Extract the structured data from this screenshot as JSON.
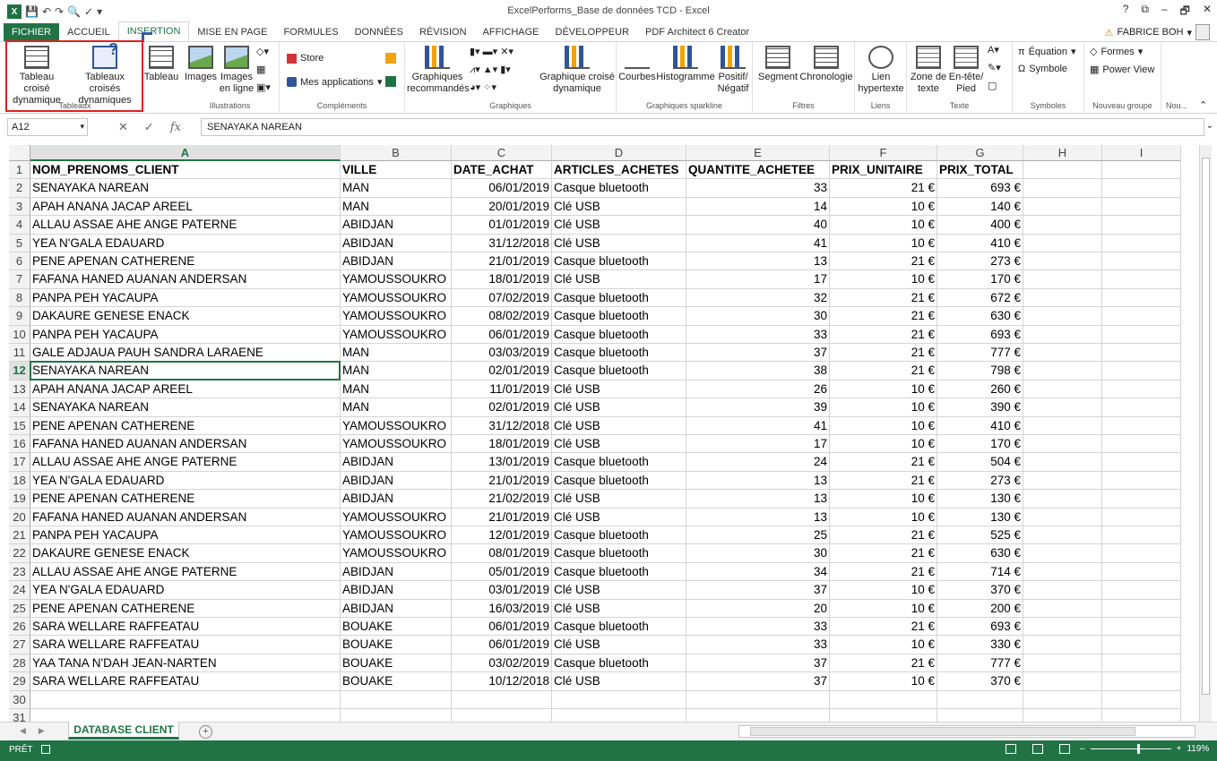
{
  "window": {
    "title": "ExcelPerforms_Base de données TCD - Excel",
    "controls": [
      "?",
      "⧉",
      "–",
      "🗗",
      "✕"
    ]
  },
  "tabs": [
    "FICHIER",
    "ACCUEIL",
    "INSERTION",
    "MISE EN PAGE",
    "FORMULES",
    "DONNÉES",
    "RÉVISION",
    "AFFICHAGE",
    "DÉVELOPPEUR",
    "PDF Architect 6 Creator"
  ],
  "user": {
    "name": "FABRICE BOH"
  },
  "ribbon": {
    "groups": {
      "tableaux": "Tableaux",
      "illustrations": "Illustrations",
      "complements": "Compléments",
      "graphiques": "Graphiques",
      "sparkline": "Graphiques sparkline",
      "filtres": "Filtres",
      "liens": "Liens",
      "texte": "Texte",
      "symboles": "Symboles",
      "nouveau": "Nouveau groupe",
      "nou": "Nou..."
    },
    "buttons": {
      "tcd": "Tableau croisé dynamique",
      "tcds": "Tableaux croisés dynamiques",
      "tableau": "Tableau",
      "images": "Images",
      "images_ligne": "Images en ligne",
      "store": "Store",
      "apps": "Mes applications",
      "graph_reco": "Graphiques recommandés",
      "graph_tcd": "Graphique croisé dynamique",
      "courbes": "Courbes",
      "histogramme": "Histogramme",
      "positif": "Positif/ Négatif",
      "segment": "Segment",
      "chronologie": "Chronologie",
      "lien": "Lien hypertexte",
      "zone": "Zone de texte",
      "entete": "En-tête/ Pied",
      "equation": "Équation",
      "symbole": "Symbole",
      "formes": "Formes",
      "powerview": "Power View"
    }
  },
  "formula_bar": {
    "name_box": "A12",
    "fx": "fx",
    "value": "SENAYAKA NAREAN"
  },
  "columns": [
    "A",
    "B",
    "C",
    "D",
    "E",
    "F",
    "G",
    "H",
    "I"
  ],
  "headers": [
    "NOM_PRENOMS_CLIENT",
    "VILLE",
    "DATE_ACHAT",
    "ARTICLES_ACHETES",
    "QUANTITE_ACHETEE",
    "PRIX_UNITAIRE",
    "PRIX_TOTAL"
  ],
  "rows": [
    [
      "SENAYAKA NAREAN",
      "MAN",
      "06/01/2019",
      "Casque bluetooth",
      "33",
      "21 €",
      "693 €"
    ],
    [
      "APAH ANANA JACAP AREEL",
      "MAN",
      "20/01/2019",
      "Clé USB",
      "14",
      "10 €",
      "140 €"
    ],
    [
      "ALLAU ASSAE AHE ANGE PATERNE",
      "ABIDJAN",
      "01/01/2019",
      "Clé USB",
      "40",
      "10 €",
      "400 €"
    ],
    [
      "YEA N'GALA EDAUARD",
      "ABIDJAN",
      "31/12/2018",
      "Clé USB",
      "41",
      "10 €",
      "410 €"
    ],
    [
      "PENE APENAN CATHERENE",
      "ABIDJAN",
      "21/01/2019",
      "Casque bluetooth",
      "13",
      "21 €",
      "273 €"
    ],
    [
      "FAFANA HANED AUANAN ANDERSAN",
      "YAMOUSSOUKRO",
      "18/01/2019",
      "Clé USB",
      "17",
      "10 €",
      "170 €"
    ],
    [
      "PANPA PEH YACAUPA",
      "YAMOUSSOUKRO",
      "07/02/2019",
      "Casque bluetooth",
      "32",
      "21 €",
      "672 €"
    ],
    [
      "DAKAURE GENESE ENACK",
      "YAMOUSSOUKRO",
      "08/02/2019",
      "Casque bluetooth",
      "30",
      "21 €",
      "630 €"
    ],
    [
      "PANPA PEH YACAUPA",
      "YAMOUSSOUKRO",
      "06/01/2019",
      "Casque bluetooth",
      "33",
      "21 €",
      "693 €"
    ],
    [
      "GALE ADJAUA PAUH SANDRA LARAENE",
      "MAN",
      "03/03/2019",
      "Casque bluetooth",
      "37",
      "21 €",
      "777 €"
    ],
    [
      "SENAYAKA NAREAN",
      "MAN",
      "02/01/2019",
      "Casque bluetooth",
      "38",
      "21 €",
      "798 €"
    ],
    [
      "APAH ANANA JACAP AREEL",
      "MAN",
      "11/01/2019",
      "Clé USB",
      "26",
      "10 €",
      "260 €"
    ],
    [
      "SENAYAKA NAREAN",
      "MAN",
      "02/01/2019",
      "Clé USB",
      "39",
      "10 €",
      "390 €"
    ],
    [
      "PENE APENAN CATHERENE",
      "YAMOUSSOUKRO",
      "31/12/2018",
      "Clé USB",
      "41",
      "10 €",
      "410 €"
    ],
    [
      "FAFANA HANED AUANAN ANDERSAN",
      "YAMOUSSOUKRO",
      "18/01/2019",
      "Clé USB",
      "17",
      "10 €",
      "170 €"
    ],
    [
      "ALLAU ASSAE AHE ANGE PATERNE",
      "ABIDJAN",
      "13/01/2019",
      "Casque bluetooth",
      "24",
      "21 €",
      "504 €"
    ],
    [
      "YEA N'GALA EDAUARD",
      "ABIDJAN",
      "21/01/2019",
      "Casque bluetooth",
      "13",
      "21 €",
      "273 €"
    ],
    [
      "PENE APENAN CATHERENE",
      "ABIDJAN",
      "21/02/2019",
      "Clé USB",
      "13",
      "10 €",
      "130 €"
    ],
    [
      "FAFANA HANED AUANAN ANDERSAN",
      "YAMOUSSOUKRO",
      "21/01/2019",
      "Clé USB",
      "13",
      "10 €",
      "130 €"
    ],
    [
      "PANPA PEH YACAUPA",
      "YAMOUSSOUKRO",
      "12/01/2019",
      "Casque bluetooth",
      "25",
      "21 €",
      "525 €"
    ],
    [
      "DAKAURE GENESE ENACK",
      "YAMOUSSOUKRO",
      "08/01/2019",
      "Casque bluetooth",
      "30",
      "21 €",
      "630 €"
    ],
    [
      "ALLAU ASSAE AHE ANGE PATERNE",
      "ABIDJAN",
      "05/01/2019",
      "Casque bluetooth",
      "34",
      "21 €",
      "714 €"
    ],
    [
      "YEA N'GALA EDAUARD",
      "ABIDJAN",
      "03/01/2019",
      "Clé USB",
      "37",
      "10 €",
      "370 €"
    ],
    [
      "PENE APENAN CATHERENE",
      "ABIDJAN",
      "16/03/2019",
      "Clé USB",
      "20",
      "10 €",
      "200 €"
    ],
    [
      "SARA WELLARE RAFFEATAU",
      "BOUAKE",
      "06/01/2019",
      "Casque bluetooth",
      "33",
      "21 €",
      "693 €"
    ],
    [
      "SARA WELLARE RAFFEATAU",
      "BOUAKE",
      "06/01/2019",
      "Clé USB",
      "33",
      "10 €",
      "330 €"
    ],
    [
      "YAA TANA N'DAH JEAN-NARTEN",
      "BOUAKE",
      "03/02/2019",
      "Casque bluetooth",
      "37",
      "21 €",
      "777 €"
    ],
    [
      "SARA WELLARE RAFFEATAU",
      "BOUAKE",
      "10/12/2018",
      "Clé USB",
      "37",
      "10 €",
      "370 €"
    ]
  ],
  "sheet": {
    "name": "DATABASE CLIENT"
  },
  "status": {
    "ready": "PRÊT",
    "zoom": "119%"
  },
  "colors": {
    "excel_green": "#217346",
    "highlight_red": "#e02020"
  }
}
